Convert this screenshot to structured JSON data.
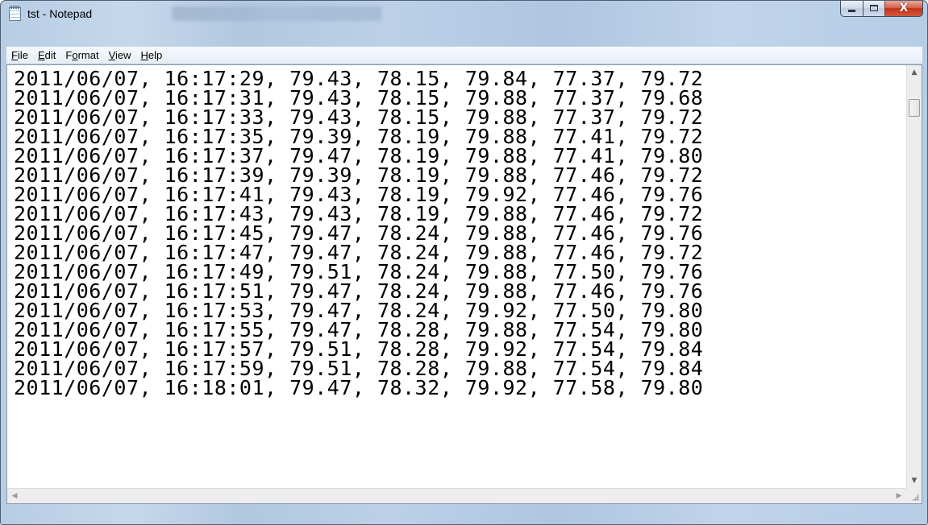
{
  "window": {
    "title": "tst - Notepad",
    "accent_color": "#c4321a",
    "frame_color": "#b7cde4"
  },
  "menubar": {
    "items": [
      {
        "label": "File",
        "mnemonic": "F"
      },
      {
        "label": "Edit",
        "mnemonic": "E"
      },
      {
        "label": "Format",
        "mnemonic": "o"
      },
      {
        "label": "View",
        "mnemonic": "V"
      },
      {
        "label": "Help",
        "mnemonic": "H"
      }
    ]
  },
  "caption_buttons": {
    "minimize_icon": "minimize-icon",
    "maximize_icon": "maximize-icon",
    "close_icon": "close-icon",
    "close_glyph": "X"
  },
  "editor": {
    "lines": [
      "2011/06/07, 16:17:29, 79.43, 78.15, 79.84, 77.37, 79.72",
      "2011/06/07, 16:17:31, 79.43, 78.15, 79.88, 77.37, 79.68",
      "2011/06/07, 16:17:33, 79.43, 78.15, 79.88, 77.37, 79.72",
      "2011/06/07, 16:17:35, 79.39, 78.19, 79.88, 77.41, 79.72",
      "2011/06/07, 16:17:37, 79.47, 78.19, 79.88, 77.41, 79.80",
      "2011/06/07, 16:17:39, 79.39, 78.19, 79.88, 77.46, 79.72",
      "2011/06/07, 16:17:41, 79.43, 78.19, 79.92, 77.46, 79.76",
      "2011/06/07, 16:17:43, 79.43, 78.19, 79.88, 77.46, 79.72",
      "2011/06/07, 16:17:45, 79.47, 78.24, 79.88, 77.46, 79.76",
      "2011/06/07, 16:17:47, 79.47, 78.24, 79.88, 77.46, 79.72",
      "2011/06/07, 16:17:49, 79.51, 78.24, 79.88, 77.50, 79.76",
      "2011/06/07, 16:17:51, 79.47, 78.24, 79.88, 77.46, 79.76",
      "2011/06/07, 16:17:53, 79.47, 78.24, 79.92, 77.50, 79.80",
      "2011/06/07, 16:17:55, 79.47, 78.28, 79.88, 77.54, 79.80",
      "2011/06/07, 16:17:57, 79.51, 78.28, 79.92, 77.54, 79.84",
      "2011/06/07, 16:17:59, 79.51, 78.28, 79.88, 77.54, 79.84",
      "2011/06/07, 16:18:01, 79.47, 78.32, 79.92, 77.58, 79.80"
    ]
  },
  "scrollbars": {
    "up_arrow": "▲",
    "down_arrow": "▼",
    "left_arrow": "◀",
    "right_arrow": "▶"
  }
}
